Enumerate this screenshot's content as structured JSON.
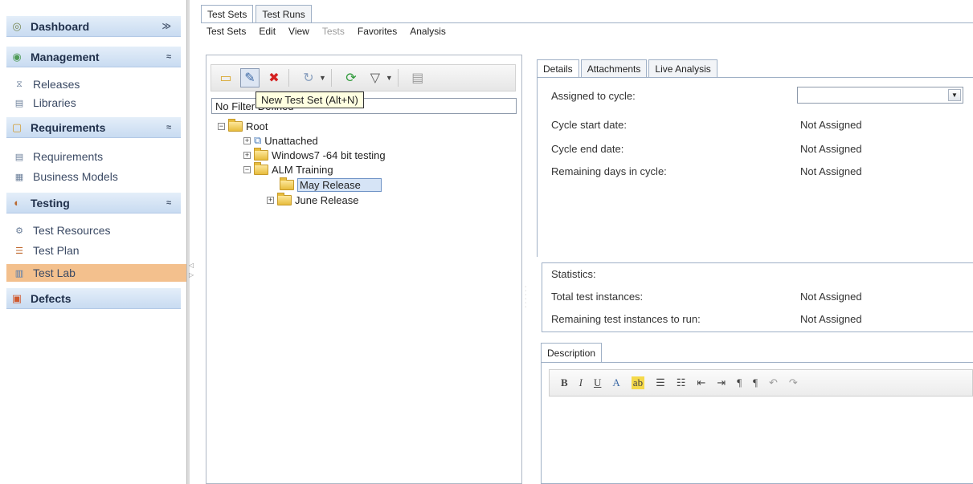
{
  "sidebar": {
    "groups": [
      {
        "label": "Dashboard",
        "icon": "dashboard-icon",
        "glyph": "◎",
        "chevron": "≫"
      },
      {
        "label": "Management",
        "icon": "management-icon",
        "glyph": "◉",
        "chevron": "≈"
      },
      {
        "label": "Requirements",
        "icon": "requirements-icon",
        "glyph": "▢",
        "chevron": "≈"
      },
      {
        "label": "Testing",
        "icon": "testing-icon",
        "glyph": "◐",
        "chevron": "≈"
      },
      {
        "label": "Defects",
        "icon": "defects-icon",
        "glyph": "▣",
        "chevron": ""
      }
    ],
    "items": [
      {
        "label": "Releases",
        "icon": "releases-icon",
        "glyph": "⧖"
      },
      {
        "label": "Libraries",
        "icon": "libraries-icon",
        "glyph": "▤"
      },
      {
        "label": "Requirements",
        "icon": "requirements-list-icon",
        "glyph": "▤"
      },
      {
        "label": "Business Models",
        "icon": "business-models-icon",
        "glyph": "▦"
      },
      {
        "label": "Test Resources",
        "icon": "test-resources-icon",
        "glyph": "⚙"
      },
      {
        "label": "Test Plan",
        "icon": "test-plan-icon",
        "glyph": "☰"
      },
      {
        "label": "Test Lab",
        "icon": "test-lab-icon",
        "glyph": "▥"
      }
    ]
  },
  "main_tabs": [
    "Test Sets",
    "Test Runs"
  ],
  "menubar": [
    "Test Sets",
    "Edit",
    "View",
    "Tests",
    "Favorites",
    "Analysis"
  ],
  "toolbar": {
    "tooltip": "New Test Set (Alt+N)",
    "buttons": [
      {
        "icon": "new-folder-icon",
        "glyph": "▭"
      },
      {
        "icon": "new-test-set-icon",
        "glyph": "✎"
      },
      {
        "icon": "delete-icon",
        "glyph": "✖"
      },
      {
        "icon": "refresh-icon",
        "glyph": "↻"
      },
      {
        "icon": "filter-refresh-icon",
        "glyph": "⟳"
      },
      {
        "icon": "filter-icon",
        "glyph": "▽"
      },
      {
        "icon": "details-icon",
        "glyph": "▤"
      }
    ]
  },
  "filter_text": "No Filter Defined",
  "tree": {
    "root": "Root",
    "nodes": [
      {
        "label": "Unattached",
        "icon": "unattached-icon"
      },
      {
        "label": "Windows7 -64 bit testing",
        "icon": "folder-icon"
      },
      {
        "label": "ALM Training",
        "icon": "folder-icon"
      },
      {
        "label": "May Release",
        "icon": "folder-icon"
      },
      {
        "label": "June Release",
        "icon": "folder-icon"
      }
    ]
  },
  "right_tabs": [
    "Details",
    "Attachments",
    "Live Analysis"
  ],
  "details": {
    "assigned_to_cycle": {
      "label": "Assigned to cycle:",
      "value": ""
    },
    "cycle_start_date": {
      "label": "Cycle start date:",
      "value": "Not Assigned"
    },
    "cycle_end_date": {
      "label": "Cycle end date:",
      "value": "Not Assigned"
    },
    "remaining_days": {
      "label": "Remaining days in cycle:",
      "value": "Not Assigned"
    }
  },
  "statistics": {
    "title": "Statistics:",
    "total": {
      "label": "Total test instances:",
      "value": "Not Assigned"
    },
    "remaining": {
      "label": "Remaining test instances to run:",
      "value": "Not Assigned"
    }
  },
  "description_tab": "Description",
  "editor_toolbar": [
    "B",
    "I",
    "U",
    "A",
    "ab",
    "☰",
    "☷",
    "⇤",
    "⇥",
    "¶",
    "¶",
    "↶",
    "↷"
  ]
}
